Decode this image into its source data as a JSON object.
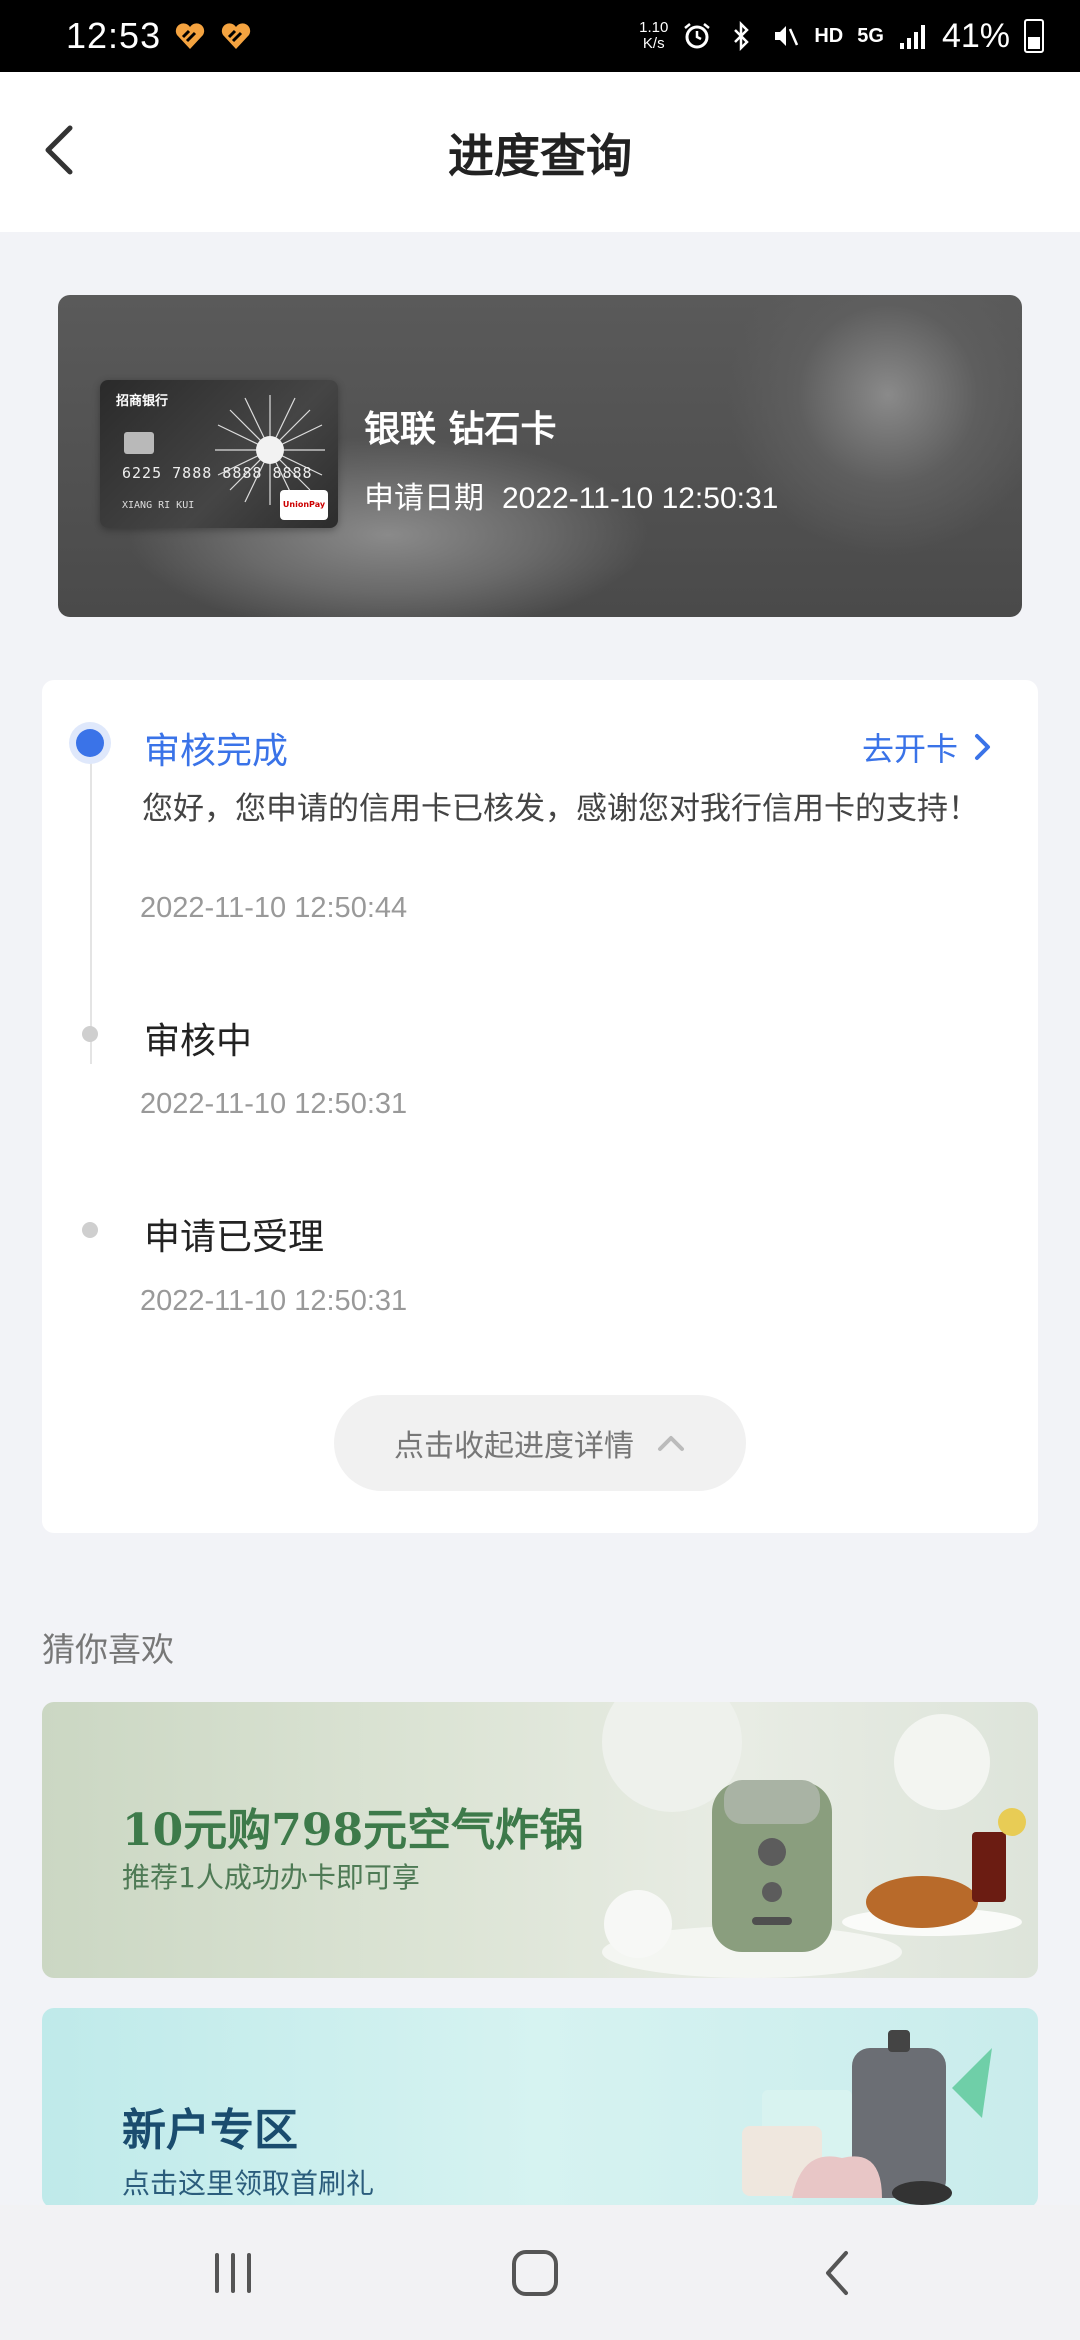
{
  "status_bar": {
    "time": "12:53",
    "net_speed_value": "1.10",
    "net_speed_unit": "K/s",
    "hd": "HD",
    "network": "5G",
    "battery": "41%"
  },
  "header": {
    "title": "进度查询"
  },
  "card": {
    "name": "银联 钻石卡",
    "date_label": "申请日期",
    "date_value": "2022-11-10 12:50:31",
    "image": {
      "bank_name": "招商银行",
      "card_number": "6225 7888 8888 8888",
      "holder": "XIANG RI KUI",
      "brand": "UnionPay 银联"
    }
  },
  "progress": {
    "steps": [
      {
        "title": "审核完成",
        "desc": "您好，您申请的信用卡已核发，感谢您对我行信用卡的支持！",
        "time": "2022-11-10 12:50:44"
      },
      {
        "title": "审核中",
        "time": "2022-11-10 12:50:31"
      },
      {
        "title": "申请已受理",
        "time": "2022-11-10 12:50:31"
      }
    ],
    "open_card_label": "去开卡",
    "collapse_label": "点击收起进度详情"
  },
  "recommend": {
    "title": "猜你喜欢",
    "promos": [
      {
        "title": "10元购798元空气炸锅",
        "subtitle": "推荐1人成功办卡即可享"
      },
      {
        "title": "新户专区",
        "subtitle": "点击这里领取首刷礼"
      }
    ]
  },
  "colors": {
    "accent": "#3a73e8",
    "page_bg": "#f2f3f7"
  }
}
